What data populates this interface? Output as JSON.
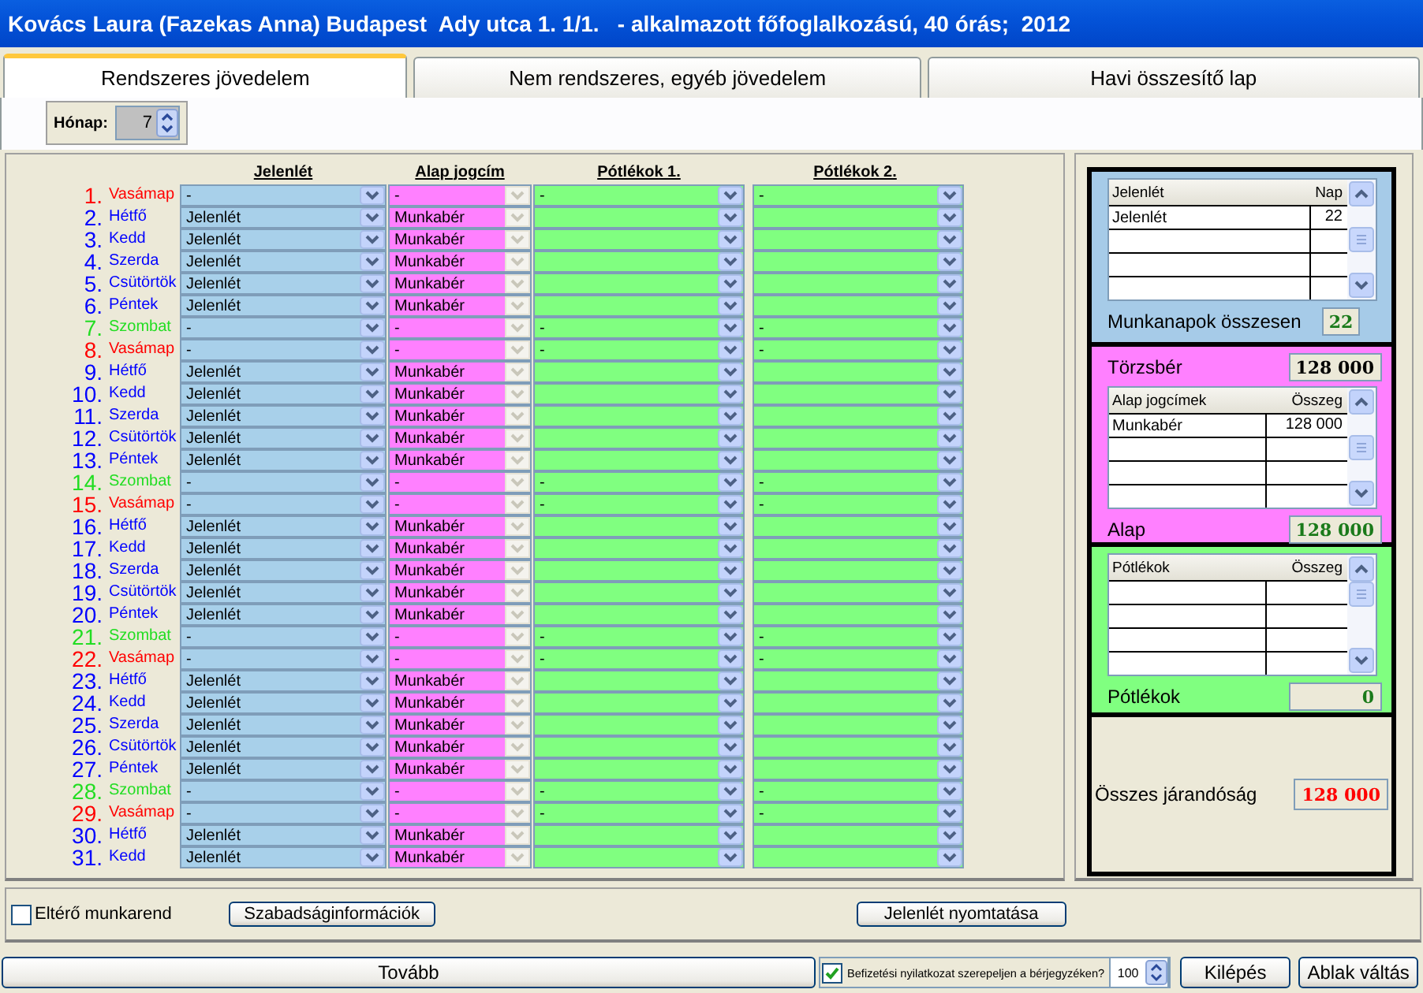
{
  "window": {
    "title": "Kovács Laura (Fazekas Anna) Budapest  Ady utca 1. 1/1.   - alkalmazott főfoglalkozású, 40 órás;  2012"
  },
  "tabs": [
    {
      "label": "Rendszeres jövedelem",
      "selected": true
    },
    {
      "label": "Nem rendszeres, egyéb jövedelem",
      "selected": false
    },
    {
      "label": "Havi összesítő lap",
      "selected": false
    }
  ],
  "month": {
    "label": "Hónap:",
    "value": "7"
  },
  "grid": {
    "columns": [
      "Jelenlét",
      "Alap jogcím",
      "Pótlékok 1.",
      "Pótlékok 2."
    ],
    "rows": [
      {
        "day": "1.",
        "name": "Vasámap",
        "color": "#ff0000",
        "jelenlet": "-",
        "alap": "-",
        "potlek_1": "-",
        "potlek_2": "-"
      },
      {
        "day": "2.",
        "name": "Hétfő",
        "color": "#0000ff",
        "jelenlet": "Jelenlét",
        "alap": "Munkabér"
      },
      {
        "day": "3.",
        "name": "Kedd",
        "color": "#0000ff",
        "jelenlet": "Jelenlét",
        "alap": "Munkabér"
      },
      {
        "day": "4.",
        "name": "Szerda",
        "color": "#0000ff",
        "jelenlet": "Jelenlét",
        "alap": "Munkabér"
      },
      {
        "day": "5.",
        "name": "Csütörtök",
        "color": "#0000ff",
        "jelenlet": "Jelenlét",
        "alap": "Munkabér"
      },
      {
        "day": "6.",
        "name": "Péntek",
        "color": "#0000ff",
        "jelenlet": "Jelenlét",
        "alap": "Munkabér"
      },
      {
        "day": "7.",
        "name": "Szombat",
        "color": "#22dd22",
        "jelenlet": "-",
        "alap": "-",
        "potlek_1": "-",
        "potlek_2": "-"
      },
      {
        "day": "8.",
        "name": "Vasámap",
        "color": "#ff0000",
        "jelenlet": "-",
        "alap": "-",
        "potlek_1": "-",
        "potlek_2": "-"
      },
      {
        "day": "9.",
        "name": "Hétfő",
        "color": "#0000ff",
        "jelenlet": "Jelenlét",
        "alap": "Munkabér"
      },
      {
        "day": "10.",
        "name": "Kedd",
        "color": "#0000ff",
        "jelenlet": "Jelenlét",
        "alap": "Munkabér"
      },
      {
        "day": "11.",
        "name": "Szerda",
        "color": "#0000ff",
        "jelenlet": "Jelenlét",
        "alap": "Munkabér"
      },
      {
        "day": "12.",
        "name": "Csütörtök",
        "color": "#0000ff",
        "jelenlet": "Jelenlét",
        "alap": "Munkabér"
      },
      {
        "day": "13.",
        "name": "Péntek",
        "color": "#0000ff",
        "jelenlet": "Jelenlét",
        "alap": "Munkabér"
      },
      {
        "day": "14.",
        "name": "Szombat",
        "color": "#22dd22",
        "jelenlet": "-",
        "alap": "-",
        "potlek_1": "-",
        "potlek_2": "-"
      },
      {
        "day": "15.",
        "name": "Vasámap",
        "color": "#ff0000",
        "jelenlet": "-",
        "alap": "-",
        "potlek_1": "-",
        "potlek_2": "-"
      },
      {
        "day": "16.",
        "name": "Hétfő",
        "color": "#0000ff",
        "jelenlet": "Jelenlét",
        "alap": "Munkabér"
      },
      {
        "day": "17.",
        "name": "Kedd",
        "color": "#0000ff",
        "jelenlet": "Jelenlét",
        "alap": "Munkabér"
      },
      {
        "day": "18.",
        "name": "Szerda",
        "color": "#0000ff",
        "jelenlet": "Jelenlét",
        "alap": "Munkabér"
      },
      {
        "day": "19.",
        "name": "Csütörtök",
        "color": "#0000ff",
        "jelenlet": "Jelenlét",
        "alap": "Munkabér"
      },
      {
        "day": "20.",
        "name": "Péntek",
        "color": "#0000ff",
        "jelenlet": "Jelenlét",
        "alap": "Munkabér"
      },
      {
        "day": "21.",
        "name": "Szombat",
        "color": "#22dd22",
        "jelenlet": "-",
        "alap": "-",
        "potlek_1": "-",
        "potlek_2": "-"
      },
      {
        "day": "22.",
        "name": "Vasámap",
        "color": "#ff0000",
        "jelenlet": "-",
        "alap": "-",
        "potlek_1": "-",
        "potlek_2": "-"
      },
      {
        "day": "23.",
        "name": "Hétfő",
        "color": "#0000ff",
        "jelenlet": "Jelenlét",
        "alap": "Munkabér"
      },
      {
        "day": "24.",
        "name": "Kedd",
        "color": "#0000ff",
        "jelenlet": "Jelenlét",
        "alap": "Munkabér"
      },
      {
        "day": "25.",
        "name": "Szerda",
        "color": "#0000ff",
        "jelenlet": "Jelenlét",
        "alap": "Munkabér"
      },
      {
        "day": "26.",
        "name": "Csütörtök",
        "color": "#0000ff",
        "jelenlet": "Jelenlét",
        "alap": "Munkabér"
      },
      {
        "day": "27.",
        "name": "Péntek",
        "color": "#0000ff",
        "jelenlet": "Jelenlét",
        "alap": "Munkabér"
      },
      {
        "day": "28.",
        "name": "Szombat",
        "color": "#22dd22",
        "jelenlet": "-",
        "alap": "-",
        "potlek_1": "-",
        "potlek_2": "-"
      },
      {
        "day": "29.",
        "name": "Vasámap",
        "color": "#ff0000",
        "jelenlet": "-",
        "alap": "-",
        "potlek_1": "-",
        "potlek_2": "-"
      },
      {
        "day": "30.",
        "name": "Hétfő",
        "color": "#0000ff",
        "jelenlet": "Jelenlét",
        "alap": "Munkabér"
      },
      {
        "day": "31.",
        "name": "Kedd",
        "color": "#0000ff",
        "jelenlet": "Jelenlét",
        "alap": "Munkabér"
      }
    ]
  },
  "presence_summary": {
    "columns": [
      "Jelenlét",
      "Nap"
    ],
    "rows": [
      [
        "Jelenlét",
        "22"
      ]
    ],
    "total_label": "Munkanapok összesen",
    "total": "22"
  },
  "base_summary": {
    "salary_label": "Törzsbér",
    "salary": "128 000",
    "columns": [
      "Alap jogcímek",
      "Összeg"
    ],
    "rows": [
      [
        "Munkabér",
        "128 000"
      ]
    ],
    "total_label": "Alap",
    "total": "128 000"
  },
  "supplements": {
    "columns": [
      "Pótlékok",
      "Összeg"
    ],
    "total_label": "Pótlékok",
    "total": "0"
  },
  "grand_total": {
    "label": "Összes járandóság",
    "value": "128 000"
  },
  "bottom": {
    "irregular_schedule": {
      "label": "Eltérő munkarend",
      "checked": false
    },
    "buttons": [
      "Szabadságinformációk",
      "Jelenlét nyomtatása"
    ]
  },
  "footer": {
    "next": "Tovább",
    "declaration": {
      "label": "Befizetési nyilatkozat szerepeljen a bérjegyzéken?",
      "checked": true
    },
    "copies": "100",
    "buttons": [
      "Kilépés",
      "Ablak váltás"
    ]
  }
}
